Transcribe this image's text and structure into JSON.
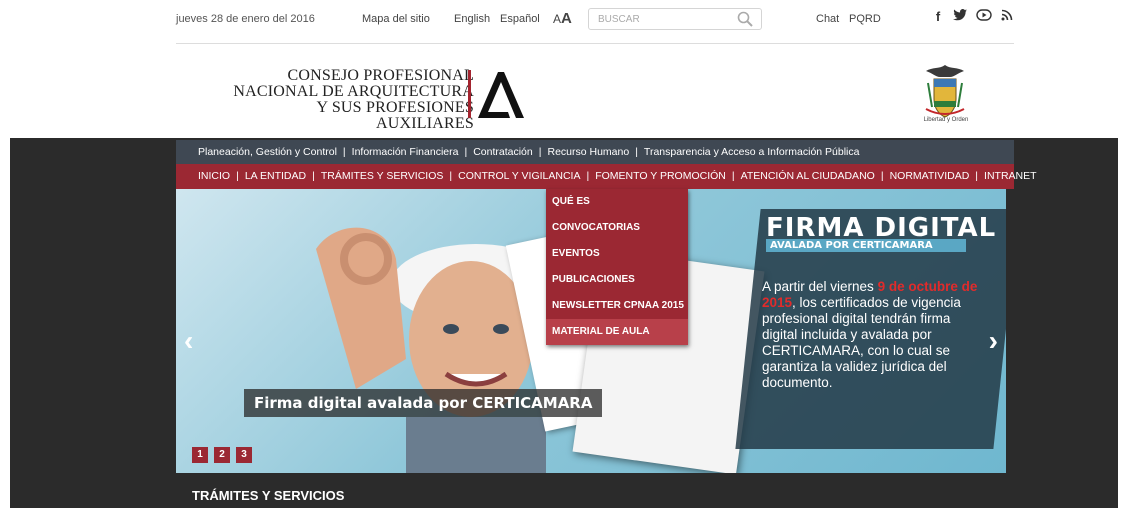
{
  "top": {
    "date": "jueves 28 de enero del 2016",
    "sitemap": "Mapa del sitio",
    "lang_en": "English",
    "lang_es": "Español",
    "font_small": "A",
    "font_large": "A",
    "search_placeholder": "BUSCAR",
    "chat": "Chat",
    "pqrd": "PQRD",
    "social": [
      {
        "icon": "facebook-icon",
        "glyph": "f"
      },
      {
        "icon": "twitter-icon",
        "glyph": "🐦"
      },
      {
        "icon": "youtube-icon",
        "glyph": "▶"
      },
      {
        "icon": "rss-icon",
        "glyph": "≋"
      }
    ]
  },
  "logo": {
    "line1": "CONSEJO PROFESIONAL",
    "line2": "NACIONAL DE ARQUITECTURA",
    "line3": "Y SUS PROFESIONES AUXILIARES"
  },
  "crest_caption": "Libertad y Orden",
  "nav_primary": [
    "Planeación, Gestión y Control",
    "Información Financiera",
    "Contratación",
    "Recurso Humano",
    "Transparencia y Acceso a Información Pública"
  ],
  "nav_secondary": [
    "INICIO",
    "LA ENTIDAD",
    "TRÁMITES Y SERVICIOS",
    "CONTROL Y VIGILANCIA",
    "FOMENTO Y PROMOCIÓN",
    "ATENCIÓN AL CIUDADANO",
    "NORMATIVIDAD",
    "INTRANET"
  ],
  "dropdown": [
    "QUÉ ES",
    "CONVOCATORIAS",
    "EVENTOS",
    "PUBLICACIONES",
    "NEWSLETTER CPNAA 2015",
    "MATERIAL DE AULA"
  ],
  "dropdown_active_index": 5,
  "slider": {
    "caption": "Firma digital avalada por CERTICAMARA",
    "banner_title": "FIRMA DIGITAL",
    "banner_subtitle": "AVALADA POR CERTICAMARA",
    "text_before": "A partir del viernes ",
    "text_highlight": "9 de octubre de 2015",
    "text_after": ", los certificados de vigencia profesional digital tendrán firma digital incluida y avalada por CERTICAMARA, con lo cual se garantiza la validez jurídica del documento.",
    "prev": "‹",
    "next": "›",
    "pages": [
      "1",
      "2",
      "3"
    ]
  },
  "section_title": "TRÁMITES Y SERVICIOS",
  "colors": {
    "nav_primary_bg": "#3f4853",
    "nav_secondary_bg": "#9b2833",
    "dark_bg": "#2b2b2b"
  }
}
